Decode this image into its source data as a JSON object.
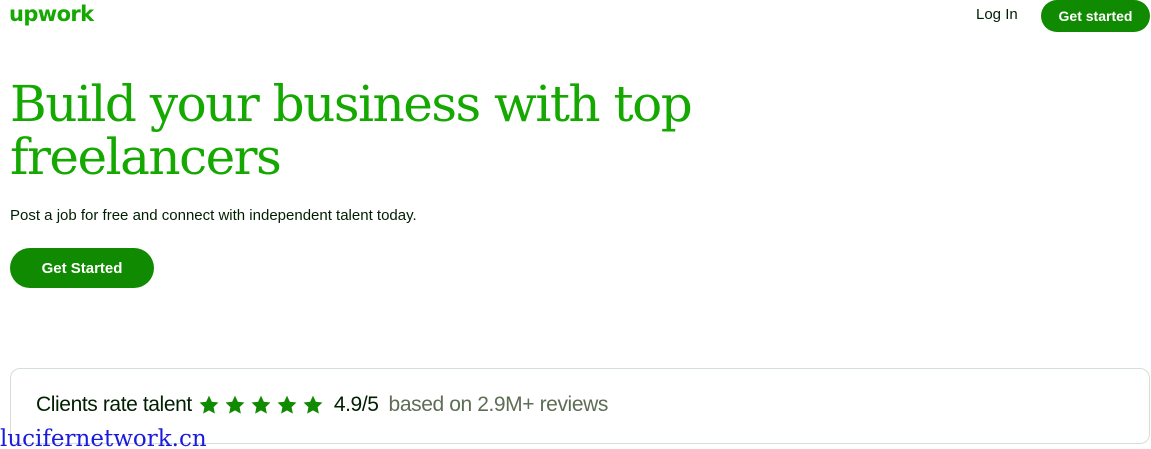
{
  "header": {
    "logo_text": "upwork",
    "login_label": "Log In",
    "cta_label": "Get started"
  },
  "hero": {
    "title": "Build your business with top freelancers",
    "subtitle": "Post a job for free and connect with independent talent today.",
    "cta_label": "Get Started"
  },
  "rating": {
    "label": "Clients rate talent",
    "stars_filled": 5,
    "stars_total": 5,
    "score": "4.9/5",
    "based_on": "based on 2.9M+ reviews"
  },
  "watermark": {
    "text": "lucifernetwork.cn"
  },
  "colors": {
    "brand_green": "#14a800",
    "button_green": "#108a00",
    "text_dark": "#001e00",
    "text_muted": "#5e6d55",
    "watermark_blue": "#1a1adf"
  },
  "icons": {
    "star": "star-icon"
  }
}
